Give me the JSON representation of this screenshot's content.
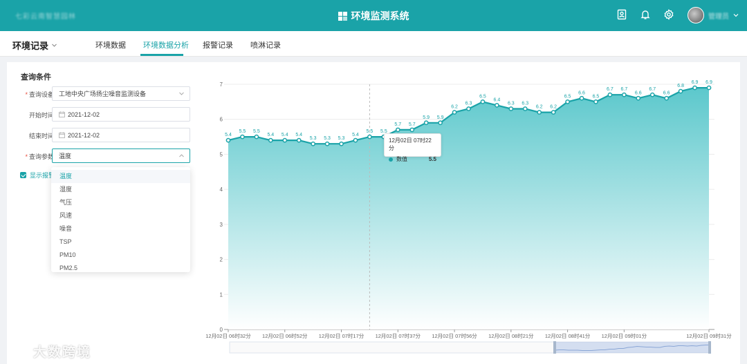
{
  "header": {
    "org_name": "七彩云南智慧园林",
    "system_title": "环境监测系统",
    "user_name": "管理员"
  },
  "nav": {
    "section_label": "环境记录",
    "tabs": [
      {
        "label": "环境数据",
        "active": false
      },
      {
        "label": "环境数据分析",
        "active": true
      },
      {
        "label": "报警记录",
        "active": false
      },
      {
        "label": "喷淋记录",
        "active": false
      }
    ]
  },
  "query": {
    "title": "查询条件",
    "device_label": "查询设备",
    "device_value": "工地中央广场扬尘噪音监测设备",
    "start_label": "开始时间",
    "start_value": "2021-12-02",
    "end_label": "结束时间",
    "end_value": "2021-12-02",
    "param_label": "查询参数",
    "param_value": "温度",
    "show_alarm_label": "显示报警",
    "param_options": [
      "温度",
      "湿度",
      "气压",
      "风速",
      "噪音",
      "TSP",
      "PM10",
      "PM2.5"
    ]
  },
  "tooltip": {
    "time": "12月02日 07时22分",
    "series_name": "数值",
    "value": "5.5"
  },
  "watermark": {
    "text": "大数跨境"
  },
  "colors": {
    "accent": "#1aa3a8",
    "area_top": "#5cc8cc",
    "area_bottom": "#ffffff"
  },
  "chart_data": {
    "type": "area",
    "series": [
      {
        "name": "数值",
        "values": [
          5.4,
          5.5,
          5.5,
          5.4,
          5.4,
          5.4,
          5.3,
          5.3,
          5.3,
          5.4,
          5.5,
          5.5,
          5.7,
          5.7,
          5.9,
          5.9,
          6.2,
          6.3,
          6.5,
          6.4,
          6.3,
          6.3,
          6.2,
          6.2,
          6.5,
          6.6,
          6.5,
          6.7,
          6.7,
          6.6,
          6.7,
          6.6,
          6.8,
          6.9,
          6.9
        ]
      }
    ],
    "x_tick_labels": [
      "12月02日 06时32分",
      "12月02日 06时52分",
      "12月02日 07时17分",
      "12月02日 07时37分",
      "12月02日 07时56分",
      "12月02日 08时21分",
      "12月02日 08时41分",
      "12月02日 09时01分",
      "12月02日 09时31分"
    ],
    "x_tick_indices": [
      0,
      4,
      8,
      12,
      16,
      20,
      24,
      28,
      34
    ],
    "y_ticks": [
      0,
      1,
      2,
      3,
      4,
      5,
      6,
      7
    ],
    "ylim": [
      0,
      7
    ],
    "hover_index": 10,
    "grid": true,
    "data_labels": true
  }
}
